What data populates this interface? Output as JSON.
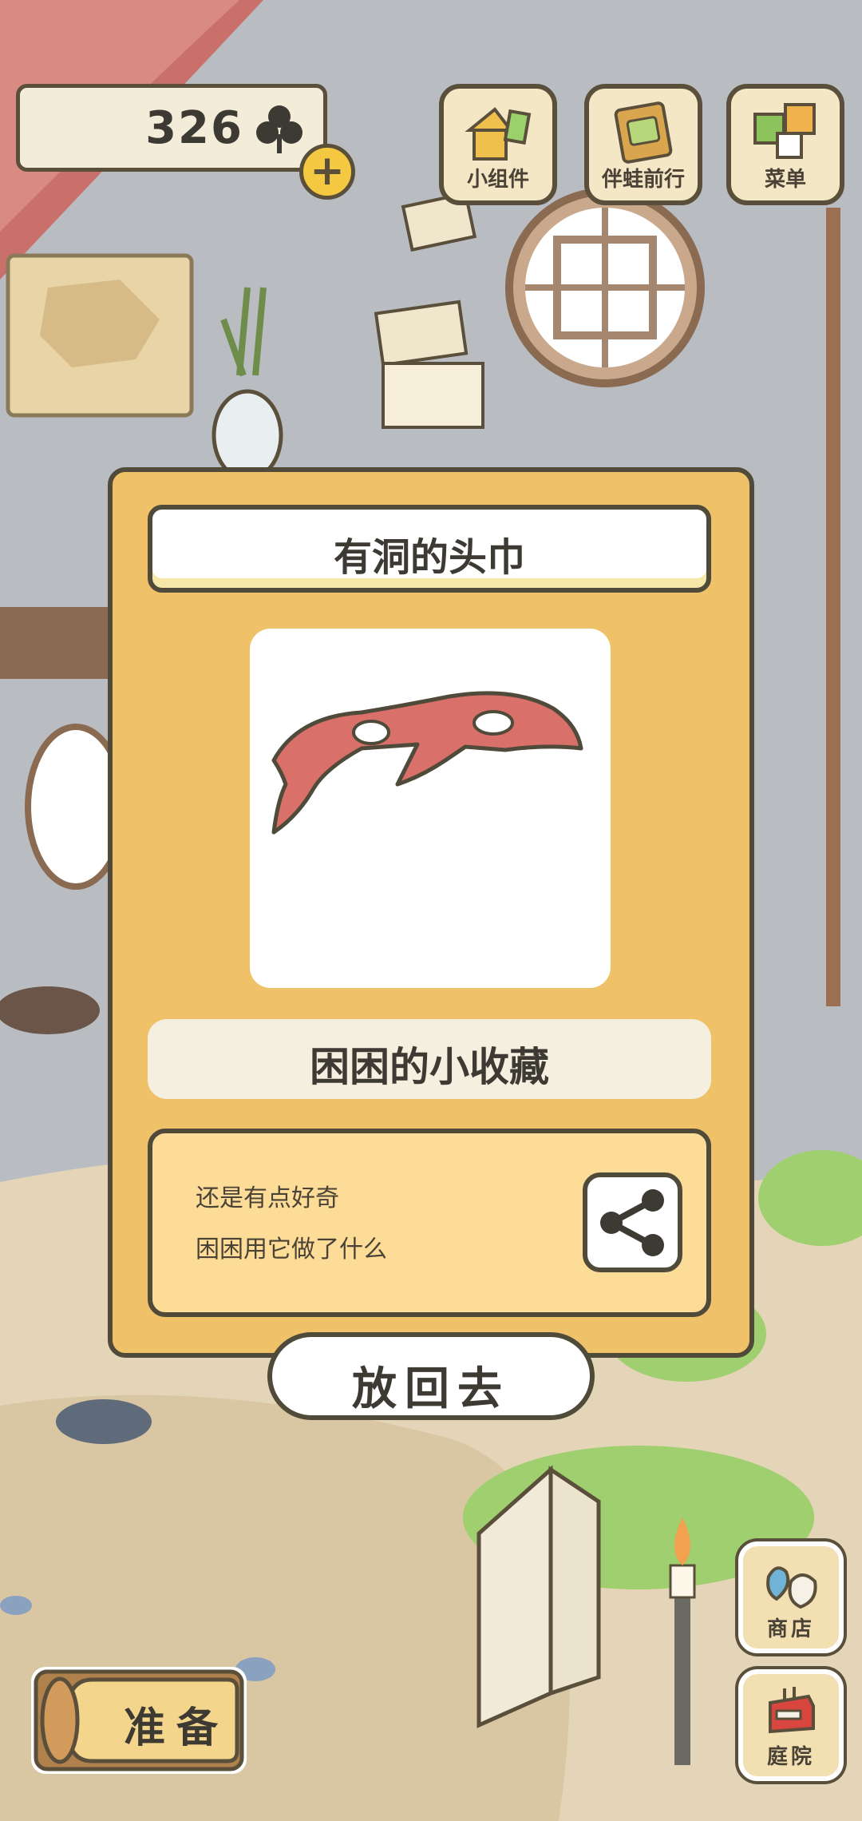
{
  "currency": {
    "amount": "326",
    "plus_label": "+"
  },
  "top_buttons": [
    {
      "label": "小组件"
    },
    {
      "label": "伴蛙前行"
    },
    {
      "label": "菜单"
    }
  ],
  "item_dialog": {
    "title": "有洞的头巾",
    "collection_label": "困困的小收藏",
    "description_lines": [
      "还是有点好奇",
      "困困用它做了什么"
    ],
    "put_back_label": "放回去"
  },
  "bottom_left": {
    "prepare_label": "准备"
  },
  "side_buttons": [
    {
      "label": "商店"
    },
    {
      "label": "庭院"
    }
  ],
  "colors": {
    "dialog_bg": "#efc26a",
    "outline": "#4f4a3a",
    "item_red": "#d9706a",
    "desc_bg": "#fddc98"
  }
}
